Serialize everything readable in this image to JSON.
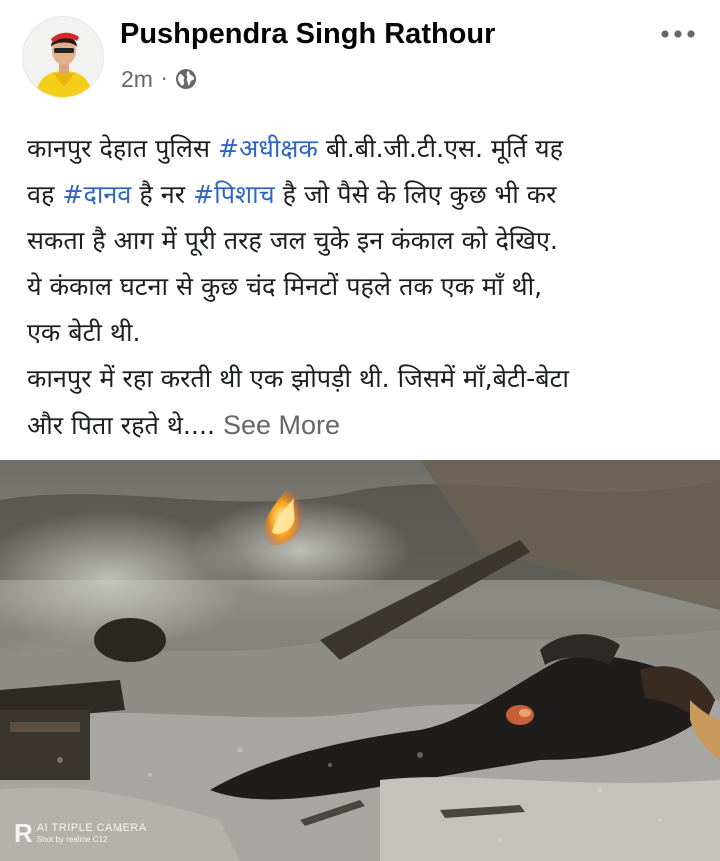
{
  "post": {
    "author": "Pushpendra Singh Rathour",
    "time": "2m",
    "separator": "·",
    "privacy_icon": "globe-icon",
    "more_icon": "more-options-icon",
    "lines": [
      {
        "parts": [
          {
            "text": "कानपुर देहात पुलिस ",
            "tag": false
          },
          {
            "text": "#अधीक्षक",
            "tag": true
          },
          {
            "text": " बी.बी.जी.टी.एस. मूर्ति यह",
            "tag": false
          }
        ]
      },
      {
        "parts": [
          {
            "text": "वह ",
            "tag": false
          },
          {
            "text": "#दानव",
            "tag": true
          },
          {
            "text": " है नर ",
            "tag": false
          },
          {
            "text": "#पिशाच",
            "tag": true
          },
          {
            "text": " है जो पैसे के लिए कुछ भी कर",
            "tag": false
          }
        ]
      },
      {
        "parts": [
          {
            "text": "सकता है आग में पूरी तरह जल चुके इन कंकाल को देखिए.",
            "tag": false
          }
        ]
      },
      {
        "parts": [
          {
            "text": "ये कंकाल घटना से कुछ चंद मिनटों पहले तक एक माँ थी,",
            "tag": false
          }
        ]
      },
      {
        "parts": [
          {
            "text": "एक बेटी थी.",
            "tag": false
          }
        ]
      },
      {
        "parts": [
          {
            "text": "कानपुर में रहा करती थी एक झोपड़ी थी. जिसमें माँ,बेटी-बेटा",
            "tag": false
          }
        ]
      },
      {
        "parts": [
          {
            "text": "और पिता रहते थे....",
            "tag": false
          }
        ]
      }
    ],
    "see_more": "See More",
    "tag_color": "#2f66c0",
    "photo": {
      "watermark_letter": "R",
      "watermark_line1": "AI TRIPLE CAMERA",
      "watermark_line2": "Shot by realme C12"
    }
  }
}
